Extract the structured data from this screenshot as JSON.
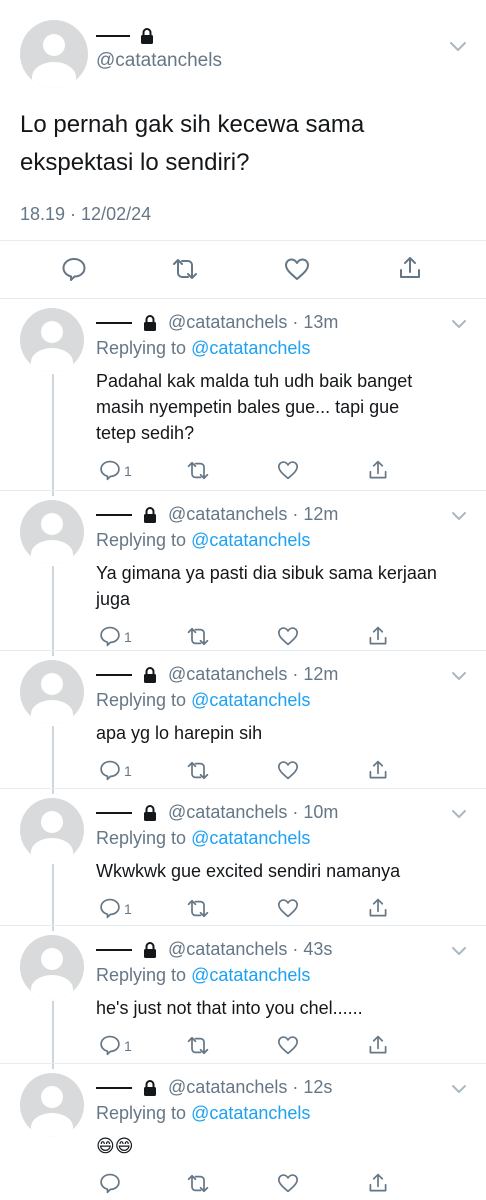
{
  "main_tweet": {
    "handle": "@catatanchels",
    "text_line1": "Lo pernah gak sih kecewa sama",
    "text_line2": "ekspektasi lo sendiri?",
    "timestamp": "18.19 · 12/02/24"
  },
  "colors": {
    "link": "#1da1f2",
    "gray": "#657786",
    "divider": "#e6ecf0",
    "avatar": "#d9dadb"
  },
  "replies": [
    {
      "handle": "@catatanchels",
      "time": "13m",
      "replying_label": "Replying to",
      "replying_to": "@catatanchels",
      "lines": [
        "Padahal kak malda tuh udh baik banget",
        "masih nyempetin bales gue... tapi gue",
        "tetep sedih?"
      ],
      "reply_count": "1"
    },
    {
      "handle": "@catatanchels",
      "time": "12m",
      "replying_label": "Replying to",
      "replying_to": "@catatanchels",
      "lines": [
        "Ya gimana ya pasti dia sibuk sama kerjaan",
        "juga"
      ],
      "reply_count": "1"
    },
    {
      "handle": "@catatanchels",
      "time": "12m",
      "replying_label": "Replying to",
      "replying_to": "@catatanchels",
      "lines": [
        "apa yg lo harepin sih"
      ],
      "reply_count": "1"
    },
    {
      "handle": "@catatanchels",
      "time": "10m",
      "replying_label": "Replying to",
      "replying_to": "@catatanchels",
      "lines": [
        "Wkwkwk gue excited sendiri namanya"
      ],
      "reply_count": "1"
    },
    {
      "handle": "@catatanchels",
      "time": "43s",
      "replying_label": "Replying to",
      "replying_to": "@catatanchels",
      "lines": [
        "he's just not that into you chel......"
      ],
      "reply_count": "1"
    },
    {
      "handle": "@catatanchels",
      "time": "12s",
      "replying_label": "Replying to",
      "replying_to": "@catatanchels",
      "lines": [
        "😄😄"
      ],
      "reply_count": ""
    }
  ],
  "icons": [
    "reply-icon",
    "retweet-icon",
    "like-icon",
    "share-icon",
    "lock-icon",
    "chevron-down-icon"
  ]
}
